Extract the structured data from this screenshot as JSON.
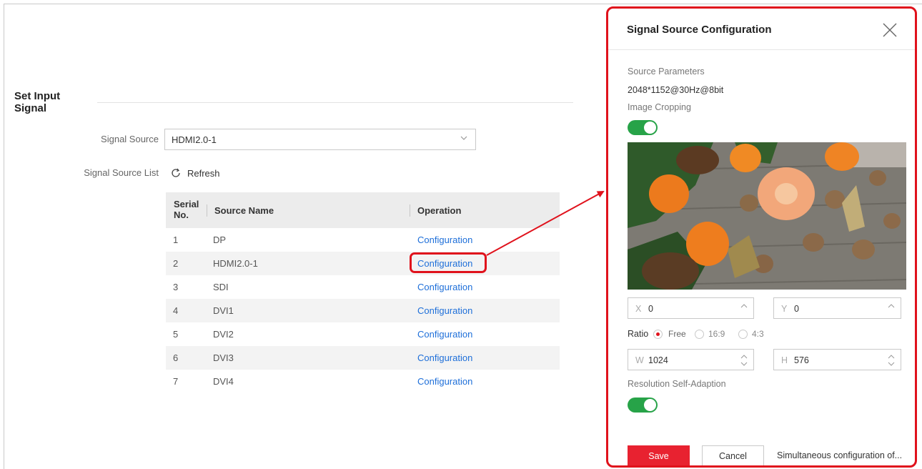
{
  "page": {
    "section_title": "Set Input Signal",
    "signal_source_label": "Signal Source",
    "signal_source_value": "HDMI2.0-1",
    "signal_source_list_label": "Signal Source List",
    "refresh_label": "Refresh"
  },
  "table": {
    "columns": [
      "Serial No.",
      "Source Name",
      "Operation"
    ],
    "rows": [
      {
        "serial": "1",
        "name": "DP",
        "operation": "Configuration"
      },
      {
        "serial": "2",
        "name": "HDMI2.0-1",
        "operation": "Configuration"
      },
      {
        "serial": "3",
        "name": "SDI",
        "operation": "Configuration"
      },
      {
        "serial": "4",
        "name": "DVI1",
        "operation": "Configuration"
      },
      {
        "serial": "5",
        "name": "DVI2",
        "operation": "Configuration"
      },
      {
        "serial": "6",
        "name": "DVI3",
        "operation": "Configuration"
      },
      {
        "serial": "7",
        "name": "DVI4",
        "operation": "Configuration"
      }
    ]
  },
  "dialog": {
    "title": "Signal Source Configuration",
    "source_params_label": "Source Parameters",
    "source_params_value": "2048*1152@30Hz@8bit",
    "image_cropping_label": "Image Cropping",
    "image_cropping_on": true,
    "x_prefix": "X",
    "x_value": "0",
    "y_prefix": "Y",
    "y_value": "0",
    "ratio_label": "Ratio",
    "ratio_options": [
      "Free",
      "16:9",
      "4:3"
    ],
    "ratio_selected": "Free",
    "w_prefix": "W",
    "w_value": "1024",
    "h_prefix": "H",
    "h_value": "576",
    "resolution_label": "Resolution Self-Adaption",
    "resolution_on": true,
    "save_label": "Save",
    "cancel_label": "Cancel",
    "simultaneous_label": "Simultaneous configuration of..."
  },
  "colors": {
    "accent_red": "#e0121c",
    "toggle_green": "#27a348",
    "link_blue": "#1e6fd9"
  }
}
